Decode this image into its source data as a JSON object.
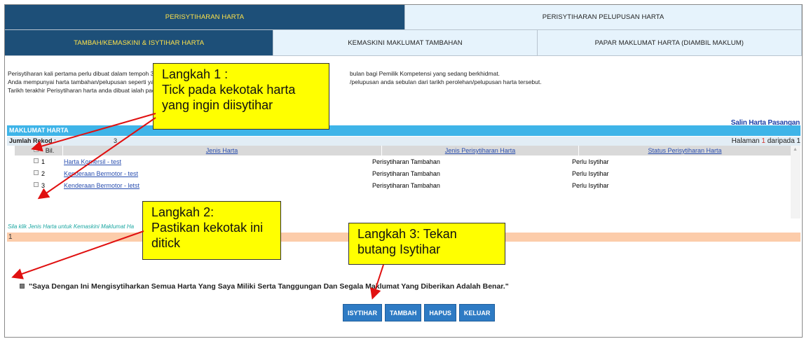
{
  "tabs_top": [
    {
      "label": "PERISYTIHARAN HARTA",
      "active": true
    },
    {
      "label": "PERISYTIHARAN PELUPUSAN HARTA",
      "active": false
    }
  ],
  "tabs_sub": [
    {
      "label": "TAMBAH/KEMASKINI & ISYTIHAR HARTA",
      "active": true
    },
    {
      "label": "KEMASKINI MAKLUMAT TAMBAHAN",
      "active": false
    },
    {
      "label": "PAPAR MAKLUMAT HARTA (DIAMBIL MAKLUM)",
      "active": false
    }
  ],
  "intro": {
    "line1_left": "Perisytiharan kali pertama perlu dibuat dalam tempoh 30",
    "line1_right": "bulan bagi Pemilik Kompetensi yang sedang berkhidmat.",
    "line2_left": "Anda mempunyai harta tambahan/pelupusan seperti yang",
    "line2_right": "/pelupusan anda sebulan dari tarikh perolehan/pelupusan harta tersebut.",
    "line3_left": "Tarikh terakhir Perisytiharan harta anda dibuat ialah pada 13/"
  },
  "partner_link": "Salin Harta Pasangan",
  "section_title": "MAKLUMAT HARTA",
  "record": {
    "label": "Jumlah Rekod :",
    "count": "3",
    "page_prefix": "Halaman",
    "page_current": "1",
    "page_suffix": "daripada 1"
  },
  "table": {
    "headers": {
      "no": "Bil.",
      "jenis_harta": "Jenis Harta",
      "jenis_perisytiharan": "Jenis Perisytiharan Harta",
      "status": "Status Perisytiharan Harta"
    },
    "rows": [
      {
        "no": "1",
        "jenis_harta": "Harta Komersil - test",
        "jenis_perisytiharan": "Perisytiharan Tambahan",
        "status": "Perlu Isytihar"
      },
      {
        "no": "2",
        "jenis_harta": "Kenderaan Bermotor - test",
        "jenis_perisytiharan": "Perisytiharan Tambahan",
        "status": "Perlu Isytihar"
      },
      {
        "no": "3",
        "jenis_harta": "Kenderaan Bermotor - letst",
        "jenis_perisytiharan": "Perisytiharan Tambahan",
        "status": "Perlu Isytihar"
      }
    ]
  },
  "hint": "Sila klik Jenis Harta untuk Kemaskini Maklumat Ha",
  "orange_bar_value": "1",
  "declaration": "\"Saya Dengan Ini Mengisytiharkan Semua Harta Yang Saya Miliki Serta Tanggungan Dan Segala Maklumat Yang Diberikan Adalah Benar.\"",
  "buttons": {
    "isytihar": "ISYTIHAR",
    "tambah": "TAMBAH",
    "hapus": "HAPUS",
    "keluar": "KELUAR"
  },
  "callouts": {
    "step1_title": "Langkah 1 :",
    "step1_text": "Tick pada kekotak harta yang ingin diisytihar",
    "step2_title": "Langkah 2:",
    "step2_text": "Pastikan kekotak ini ditick",
    "step3_text": "Langkah 3: Tekan butang Isytihar"
  },
  "colors": {
    "active_tab": "#1d4f78",
    "active_tab_text": "#ffe34a",
    "section_bar": "#3eb4e8",
    "button": "#2e7bc4",
    "callout": "#ffff00",
    "arrow": "#e01010"
  }
}
